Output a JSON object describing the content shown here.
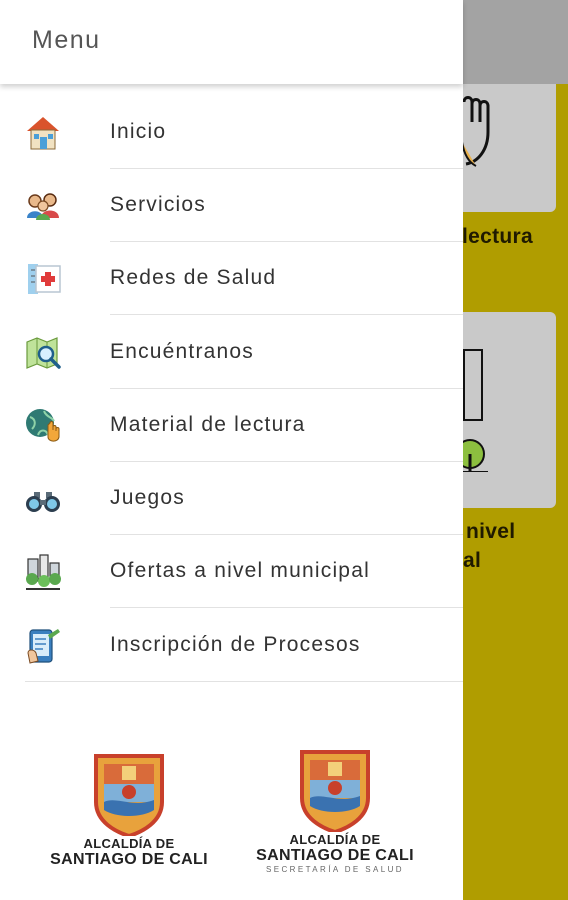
{
  "drawer": {
    "title": "Menu",
    "items": [
      {
        "label": "Inicio",
        "icon": "home-icon"
      },
      {
        "label": "Servicios",
        "icon": "people-icon"
      },
      {
        "label": "Redes de Salud",
        "icon": "hospital-icon"
      },
      {
        "label": "Encuéntranos",
        "icon": "map-search-icon"
      },
      {
        "label": "Material de lectura",
        "icon": "globe-hand-icon"
      },
      {
        "label": "Juegos",
        "icon": "binoculars-icon"
      },
      {
        "label": "Ofertas a nivel municipal",
        "icon": "city-icon"
      },
      {
        "label": "Inscripción de Procesos",
        "icon": "tablet-form-icon"
      }
    ],
    "logos": [
      {
        "line1": "ALCALDÍA DE",
        "line2": "SANTIAGO DE CALI"
      },
      {
        "line1": "ALCALDÍA DE",
        "line2": "SANTIAGO DE CALI",
        "line3": "SECRETARÍA DE SALUD"
      }
    ]
  },
  "background": {
    "card_labels": [
      "lectura",
      "nivel",
      "al"
    ],
    "accent_color": "#b09d00"
  }
}
